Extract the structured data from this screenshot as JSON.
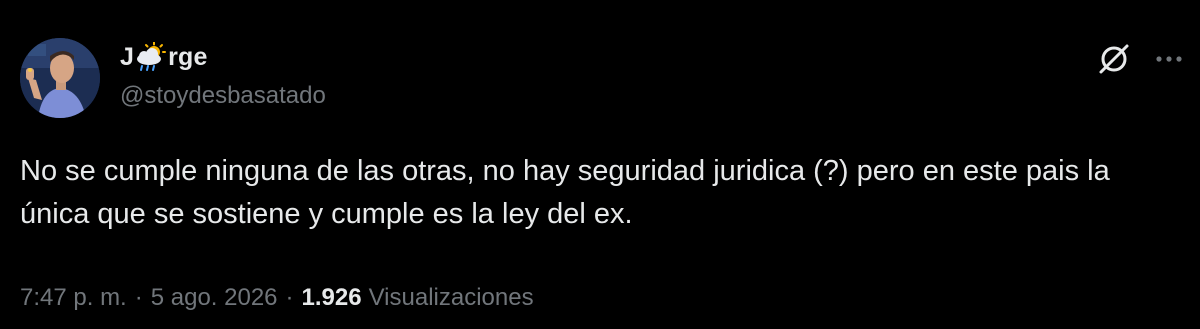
{
  "author": {
    "name_prefix": "J",
    "name_emoji": "sun-behind-rain-cloud-emoji",
    "name_suffix": "rge",
    "handle": "@stoydesbasatado"
  },
  "tweet": {
    "text": "No se cumple ninguna de las otras, no hay seguridad juridica (?) pero en este pais la única que se sostiene y cumple es la ley del ex."
  },
  "meta": {
    "time": "7:47 p. m.",
    "separator": "·",
    "date": "5 ago. 2026",
    "views_count": "1.926",
    "views_label": "Visualizaciones"
  },
  "icons": {
    "grok": "grok-icon",
    "more": "more-icon",
    "avatar": "avatar"
  },
  "colors": {
    "background": "#000000",
    "primary_text": "#e7e9ea",
    "secondary_text": "#71767b"
  }
}
